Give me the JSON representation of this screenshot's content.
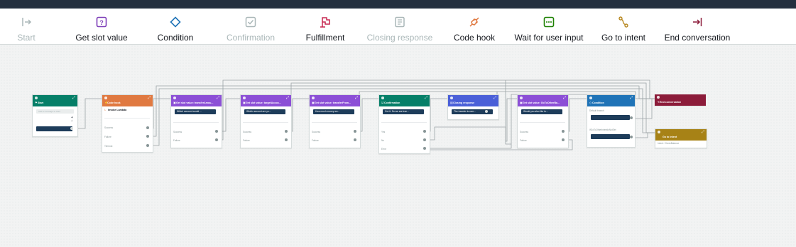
{
  "toolbar": {
    "items": [
      {
        "label": "Start",
        "icon": "start-icon",
        "color": "#aab7b8",
        "disabled": true
      },
      {
        "label": "Get slot value",
        "icon": "slot-icon",
        "color": "#7d3eb8"
      },
      {
        "label": "Condition",
        "icon": "condition-icon",
        "color": "#1f73b7"
      },
      {
        "label": "Confirmation",
        "icon": "checkbox-icon",
        "color": "#aab7b8",
        "disabled": true
      },
      {
        "label": "Fulfillment",
        "icon": "flag-icon",
        "color": "#c7254e"
      },
      {
        "label": "Closing response",
        "icon": "document-icon",
        "color": "#aab7b8",
        "disabled": true
      },
      {
        "label": "Code hook",
        "icon": "plug-icon",
        "color": "#e07941"
      },
      {
        "label": "Wait for user input",
        "icon": "wait-icon",
        "color": "#1d8102"
      },
      {
        "label": "Go to intent",
        "icon": "route-icon",
        "color": "#b7871f"
      },
      {
        "label": "End conversation",
        "icon": "end-icon",
        "color": "#8c1c3a"
      }
    ]
  },
  "nodes": {
    "start": {
      "title": "Start",
      "color": "#067f68",
      "placeholder": "Add a message to start"
    },
    "codehook": {
      "title": "Code hook",
      "color": "#e07941",
      "lambda": "Invoke Lambda",
      "rows": [
        "Success",
        "Failure",
        "Timeout"
      ]
    },
    "slot1": {
      "title": "Get slot value: transferAmou...",
      "color": "#8c4fd6",
      "prompt": "Which account would ...",
      "rows": [
        "Success",
        "Failure"
      ]
    },
    "slot2": {
      "title": "Get slot value: targetAccou...",
      "color": "#8c4fd6",
      "prompt": "Which account are yo...",
      "rows": [
        "Success",
        "Failure"
      ]
    },
    "slot3": {
      "title": "Get slot value: transferFrom...",
      "color": "#8c4fd6",
      "prompt": "How much money wo...",
      "rows": [
        "Success",
        "Failure"
      ]
    },
    "confirm": {
      "title": "Confirmation",
      "color": "#067f68",
      "prompt": "Got it. So we are tran...",
      "rows": [
        "Yes",
        "No",
        "Error"
      ]
    },
    "closing": {
      "title": "Closing response",
      "color": "#4a5fd8",
      "prompt": "The transfer is com..."
    },
    "slot4": {
      "title": "Get slot value: GoToOtherBa...",
      "color": "#8c4fd6",
      "prompt": "Would you also like to...",
      "rows": [
        "Success",
        "Failure"
      ]
    },
    "condition": {
      "title": "Condition",
      "color": "#1f73b7",
      "branches": [
        "Default branch",
        "IfGoToOtherIntentIsNotSet"
      ]
    },
    "end": {
      "title": "End conversation",
      "color": "#8c1c3a"
    },
    "goto": {
      "title": "Go to intent",
      "color": "#a78216",
      "sub": "Intent: CheckBalance"
    }
  }
}
